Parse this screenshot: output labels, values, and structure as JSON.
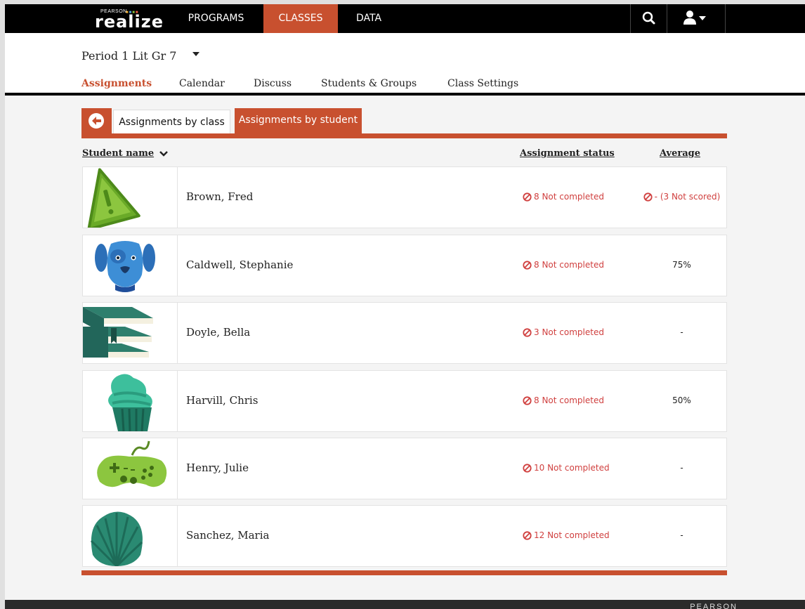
{
  "app": {
    "brand_small": "PEARSON",
    "brand": "realize"
  },
  "nav": {
    "programs": "PROGRAMS",
    "classes": "CLASSES",
    "data": "DATA"
  },
  "class_header": {
    "class_name": "Period 1 Lit Gr 7",
    "tabs": [
      "Assignments",
      "Calendar",
      "Discuss",
      "Students & Groups",
      "Class Settings"
    ],
    "active_tab": "Assignments"
  },
  "view_tabs": {
    "by_class": "Assignments by class",
    "by_student": "Assignments by student",
    "active": "Assignments by student"
  },
  "table": {
    "headers": {
      "name": "Student name",
      "status": "Assignment status",
      "average": "Average"
    },
    "rows": [
      {
        "avatar": "warning-icon-avatar",
        "name": "Brown, Fred",
        "status": "8 Not completed",
        "average": "- (3 Not scored)"
      },
      {
        "avatar": "dog-avatar",
        "name": "Caldwell, Stephanie",
        "status": "8 Not completed",
        "average": "75%"
      },
      {
        "avatar": "books-avatar",
        "name": "Doyle, Bella",
        "status": "3 Not completed",
        "average": "-"
      },
      {
        "avatar": "cupcake-avatar",
        "name": "Harvill, Chris",
        "status": "8 Not completed",
        "average": "50%"
      },
      {
        "avatar": "game-controller-avatar",
        "name": "Henry, Julie",
        "status": "10 Not completed",
        "average": "-"
      },
      {
        "avatar": "seashell-avatar",
        "name": "Sanchez, Maria",
        "status": "12 Not completed",
        "average": "-"
      }
    ]
  },
  "footer": {
    "brand": "PEARSON"
  },
  "colors": {
    "accent": "#c8502f",
    "alert": "#d0403f",
    "nav_bg": "#000000"
  }
}
